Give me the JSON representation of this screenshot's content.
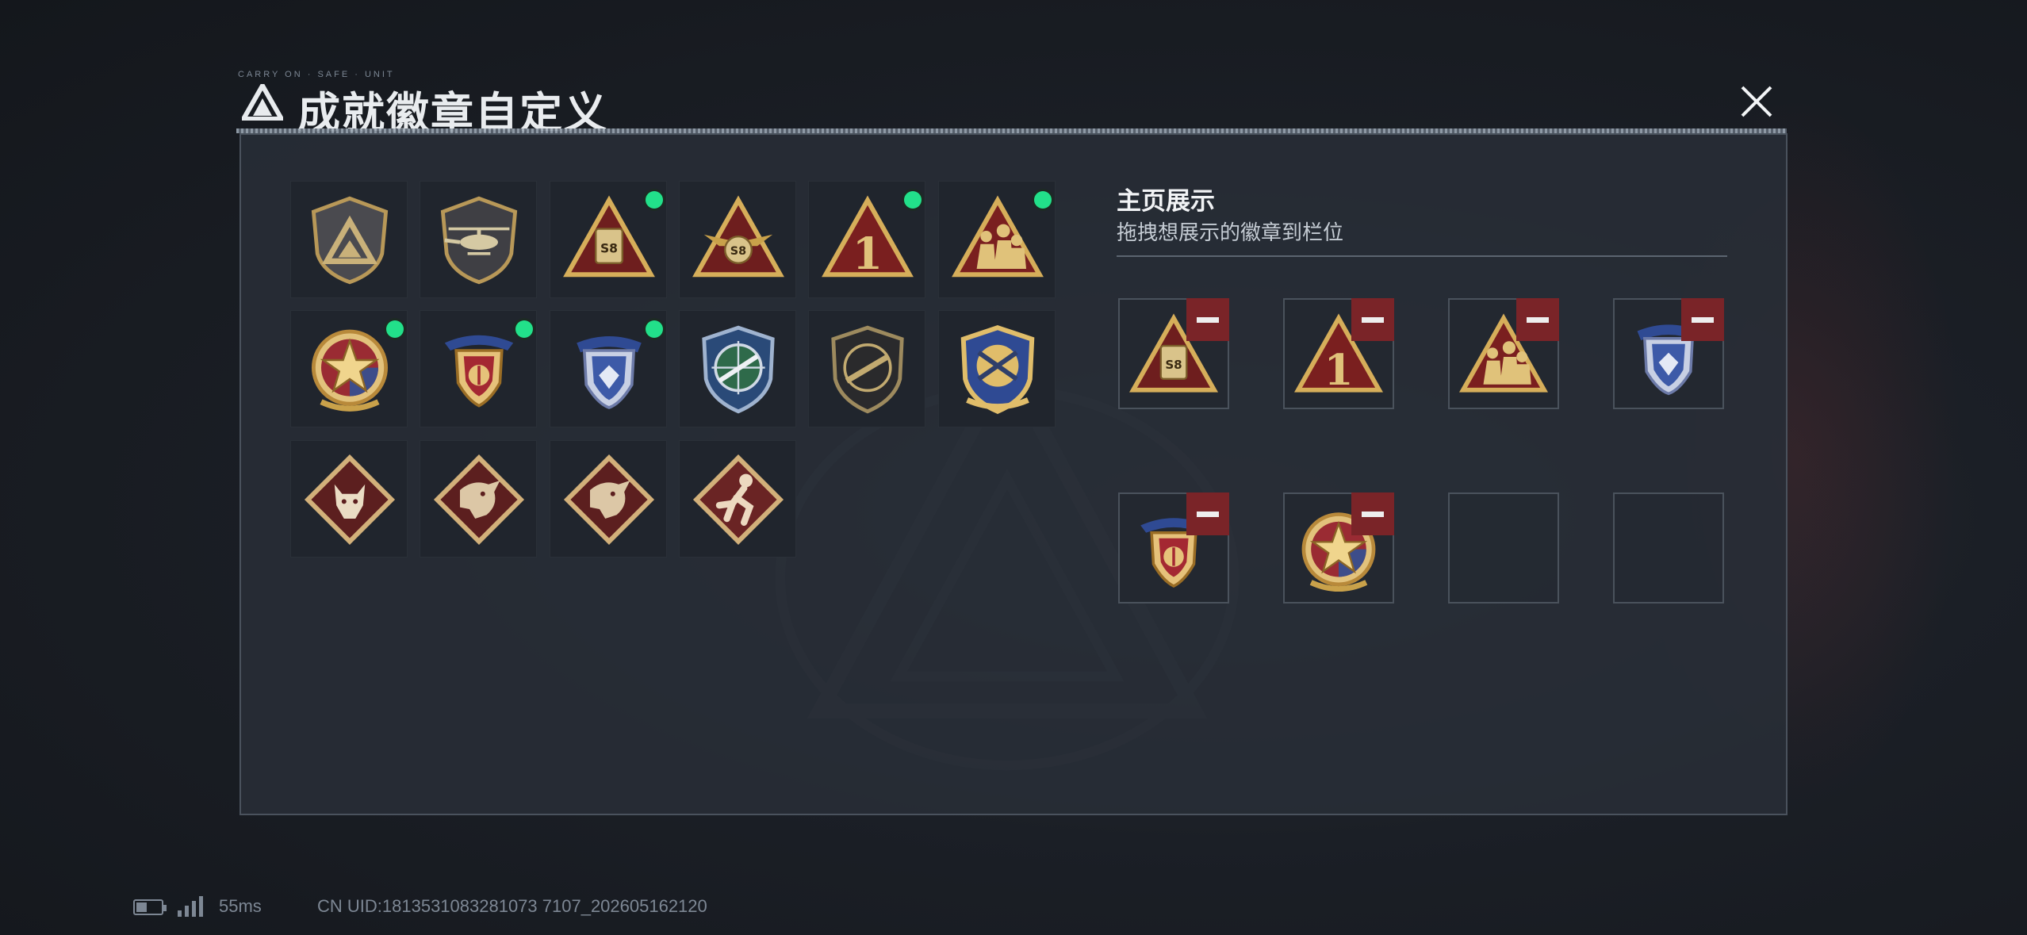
{
  "window": {
    "title": "成就徽章自定义",
    "micro_text": "CARRY ON · SAFE · UNIT"
  },
  "colors": {
    "accent_online": "#22e08a",
    "remove": "#7a2428",
    "gold": "#c9a14a"
  },
  "badges": [
    {
      "name": "shield-triangle-badge",
      "owned_dot": false
    },
    {
      "name": "helicopter-badge",
      "owned_dot": false
    },
    {
      "name": "s8-triangle-badge",
      "owned_dot": true
    },
    {
      "name": "s8-winged-triangle-badge",
      "owned_dot": false
    },
    {
      "name": "number-one-triangle-badge",
      "owned_dot": true
    },
    {
      "name": "soldiers-triangle-badge",
      "owned_dot": true
    },
    {
      "name": "red-star-medal-badge",
      "owned_dot": true
    },
    {
      "name": "navy-crest-medal-badge",
      "owned_dot": true
    },
    {
      "name": "blue-diamond-shield-badge",
      "owned_dot": true
    },
    {
      "name": "crosshair-rifle-badge",
      "owned_dot": false
    },
    {
      "name": "dark-rifle-shield-badge",
      "owned_dot": false
    },
    {
      "name": "gold-cross-guns-badge",
      "owned_dot": false
    },
    {
      "name": "wolf-diamond-badge",
      "owned_dot": false
    },
    {
      "name": "dragon-diamond-badge",
      "owned_dot": false
    },
    {
      "name": "dragon-diamond-badge-2",
      "owned_dot": false
    },
    {
      "name": "runner-diamond-badge",
      "owned_dot": false
    }
  ],
  "showcase": {
    "title": "主页展示",
    "subtitle": "拖拽想展示的徽章到栏位",
    "slots": [
      {
        "badge": "s8-triangle-badge"
      },
      {
        "badge": "number-one-triangle-badge"
      },
      {
        "badge": "soldiers-triangle-badge"
      },
      {
        "badge": "blue-diamond-shield-badge"
      },
      {
        "badge": "navy-crest-medal-badge"
      },
      {
        "badge": "red-star-medal-badge"
      },
      {
        "badge": ""
      },
      {
        "badge": ""
      }
    ]
  },
  "status": {
    "ping": "55ms",
    "uid": "CN UID:1813531083281073 7107_202605162120"
  }
}
